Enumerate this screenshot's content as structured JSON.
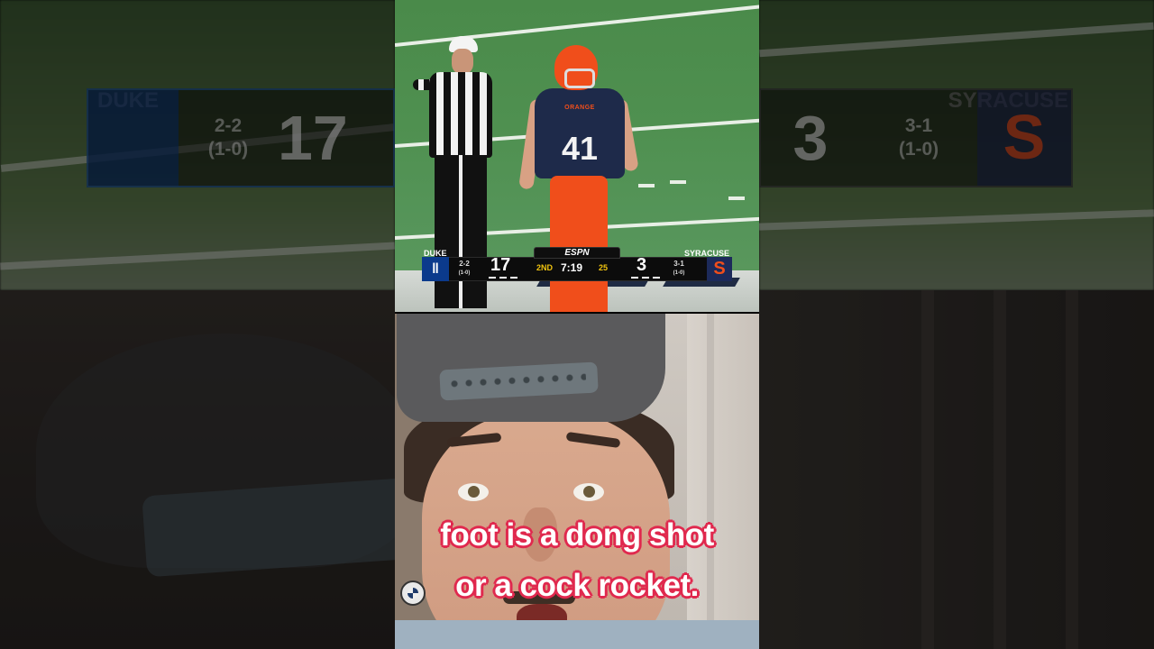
{
  "scorebug": {
    "network": "ESPN",
    "away": {
      "name": "DUKE",
      "record": "2-2",
      "conf_record": "(1-0)",
      "score": "17",
      "logo_icon": "duke-d-logo"
    },
    "home": {
      "name": "SYRACUSE",
      "record": "3-1",
      "conf_record": "(1-0)",
      "score": "3",
      "logo_icon": "syracuse-s-logo"
    },
    "quarter": "2ND",
    "clock": "7:19",
    "play_clock": "25"
  },
  "player": {
    "number": "41",
    "jersey_wordmark": "ORANGE"
  },
  "caption": {
    "line1": "foot is a dong shot",
    "line2": "or a cock rocket."
  },
  "colors": {
    "caption_outline": "#e0294e",
    "syracuse_orange": "#f04e1b",
    "duke_blue": "#0b3a8c",
    "clock_yellow": "#f1c40f"
  }
}
